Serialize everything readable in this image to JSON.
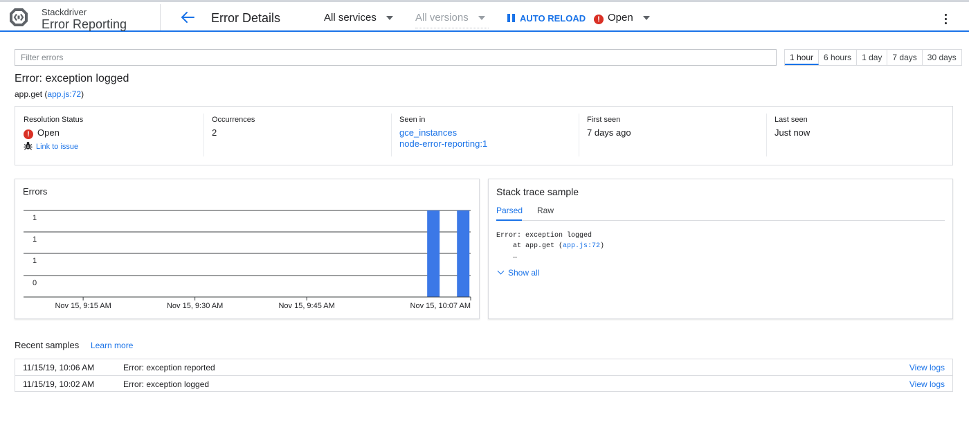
{
  "header": {
    "brand_small": "Stackdriver",
    "brand_big": "Error Reporting",
    "page_title": "Error Details",
    "services": "All services",
    "versions": "All versions",
    "auto_reload": "AUTO RELOAD",
    "status": "Open",
    "accent_color": "#1a73e8"
  },
  "filter": {
    "placeholder": "Filter errors",
    "value": ""
  },
  "time_ranges": [
    {
      "label": "1 hour",
      "active": true
    },
    {
      "label": "6 hours",
      "active": false
    },
    {
      "label": "1 day",
      "active": false
    },
    {
      "label": "7 days",
      "active": false
    },
    {
      "label": "30 days",
      "active": false
    }
  ],
  "error": {
    "title": "Error: exception logged",
    "function": "app.get",
    "location": "app.js:72"
  },
  "summary": {
    "resolution_label": "Resolution Status",
    "resolution_value": "Open",
    "link_to_issue": "Link to issue",
    "occurrences_label": "Occurrences",
    "occurrences_value": "2",
    "seen_in_label": "Seen in",
    "seen_in_1": "gce_instances",
    "seen_in_2": "node-error-reporting:1",
    "first_seen_label": "First seen",
    "first_seen_value": "7 days ago",
    "last_seen_label": "Last seen",
    "last_seen_value": "Just now"
  },
  "chart_card": {
    "title": "Errors"
  },
  "chart_data": {
    "type": "bar",
    "title": "Errors",
    "xlabel": "",
    "ylabel": "",
    "y_tick_labels": [
      "1",
      "1",
      "1",
      "0"
    ],
    "x_tick_labels": [
      "Nov 15, 9:15 AM",
      "Nov 15, 9:30 AM",
      "Nov 15, 9:45 AM",
      "Nov 15, 10:07 AM"
    ],
    "x_range": [
      "Nov 15, 9:07 AM",
      "Nov 15, 10:07 AM"
    ],
    "ylim": [
      0,
      1
    ],
    "categories": [
      "Nov 15, 10:02 AM",
      "Nov 15, 10:06 AM"
    ],
    "values": [
      1,
      1
    ],
    "bar_color": "#3b78e7",
    "grid": true
  },
  "stack": {
    "title": "Stack trace sample",
    "tab_parsed": "Parsed",
    "tab_raw": "Raw",
    "line1": "Error: exception logged",
    "line2_prefix": "    at app.get (",
    "line2_link": "app.js:72",
    "line2_suffix": ")",
    "line3": "    …",
    "show_all": "Show all"
  },
  "recent": {
    "title": "Recent samples",
    "learn_more": "Learn more",
    "rows": [
      {
        "time": "11/15/19, 10:06 AM",
        "message": "Error: exception reported",
        "action": "View logs"
      },
      {
        "time": "11/15/19, 10:02 AM",
        "message": "Error: exception logged",
        "action": "View logs"
      }
    ]
  }
}
